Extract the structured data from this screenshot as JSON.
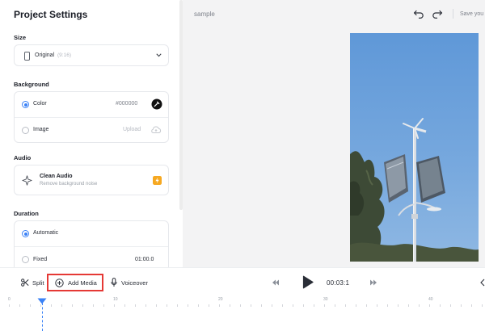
{
  "panel": {
    "title": "Project Settings",
    "size": {
      "label": "Size",
      "value": "Original",
      "ratio": "(9:16)"
    },
    "background": {
      "label": "Background",
      "options": [
        {
          "label": "Color",
          "value": "#000000",
          "selected": true
        },
        {
          "label": "Image",
          "value": "Upload",
          "selected": false
        }
      ]
    },
    "audio": {
      "label": "Audio",
      "feature_title": "Clean Audio",
      "feature_desc": "Remove background noise"
    },
    "duration": {
      "label": "Duration",
      "options": [
        {
          "label": "Automatic",
          "selected": true
        },
        {
          "label": "Fixed",
          "value": "01:00.0",
          "selected": false
        }
      ]
    }
  },
  "preview": {
    "project_name": "sample",
    "save_text": "Save you"
  },
  "toolbar": {
    "split": "Split",
    "add_media": "Add Media",
    "voiceover": "Voiceover",
    "time": "00:03:1"
  },
  "timeline": {
    "ticks": [
      "0",
      "10",
      "20",
      "30",
      "40"
    ],
    "playhead_seconds": 3.1
  },
  "colors": {
    "accent": "#3b82f6",
    "highlight": "#e53935",
    "premium_badge": "#f6a821",
    "sky": "#6c9fd6"
  }
}
